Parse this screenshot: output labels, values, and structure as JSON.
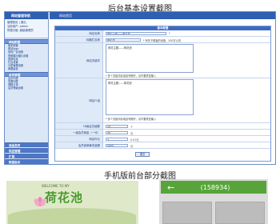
{
  "titles": {
    "admin_section": "后台基本设置截图",
    "mobile_section": "手机版前台部分截图"
  },
  "sidebar": {
    "header": "网站管理导航",
    "info_line1": "管理首页 | 退出",
    "info_line2": "当前用户: admin",
    "info_line3": "所属分组: 超级管理员",
    "groups": [
      {
        "label": "网站配置",
        "items": [
          "基本配置",
          "网站logo",
          "首页广告设置",
          "视频展示图片设置",
          "底部信息",
          "栏目设置",
          "分类管理设置",
          "我要留言"
        ]
      },
      {
        "label": "会员管理",
        "items": [
          "会员列表",
          "发展列表",
          "课程订单",
          "会员等级设置"
        ]
      }
    ],
    "bottom_groups": [
      "商品发布",
      "供应管理",
      "扩展",
      "数据备份"
    ]
  },
  "main": {
    "topbar_title": "网站首页",
    "panel_title": "基本配置",
    "rows": [
      {
        "label": "网站名称",
        "value": "荷花主题——荷花池",
        "hint": "*"
      },
      {
        "label": "标题栏名称",
        "value": "荷花池",
        "hint": "* 有关于模板的设置，200字以内"
      },
      {
        "label": "网站关键字",
        "value": "荷花主题——荷花池",
        "hint": "* 多个关键词请用逗号隔开，请不要重复输入"
      },
      {
        "label": "网站介绍",
        "value": "荷花主题——荷花池",
        "hint": "* 多个关键词请用逗号隔开，请不要重复输入"
      },
      {
        "label": "16级会员级数",
        "value": "10",
        "hint": "个"
      },
      {
        "label": "一级会员佣金（一代）",
        "value": "30",
        "hint": "元"
      },
      {
        "label": "网站币元",
        "value": "1",
        "hint": "0.01元"
      },
      {
        "label": "会员保单最低金额",
        "value": "5000",
        "hint": "元"
      }
    ],
    "submit_label": "提交"
  },
  "mobile": {
    "welcome": "WELCOME TO MY",
    "brand": "荷花池",
    "header_number": "(158934)",
    "back_icon": "arrow-left-icon"
  },
  "colors": {
    "nav_blue": "#2f5fb3",
    "sidebar_bg": "#dbe7f7",
    "mobile_green": "#57a53a"
  }
}
